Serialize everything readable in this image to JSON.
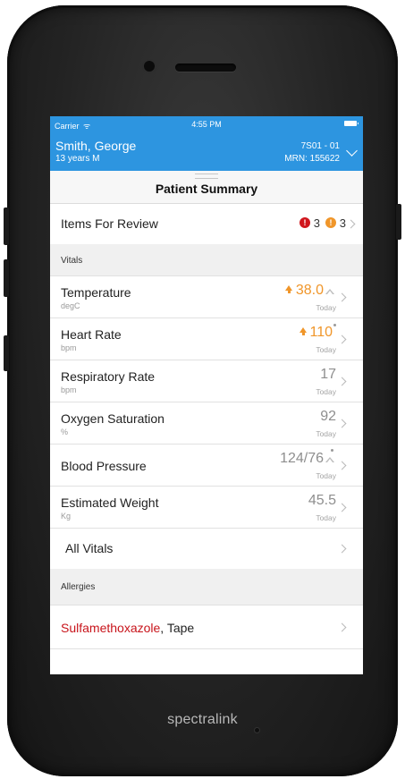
{
  "status_bar": {
    "carrier": "Carrier",
    "wifi_icon": "wifi-icon",
    "time": "4:55 PM",
    "battery_icon": "battery-icon"
  },
  "patient": {
    "name": "Smith, George",
    "age_sex": "13 years  M",
    "location": "7S01 - 01",
    "mrn": "MRN: 155622"
  },
  "page_title": "Patient Summary",
  "review": {
    "label": "Items For Review",
    "red_count": "3",
    "orange_count": "3",
    "red_icon": "!",
    "orange_icon": "!"
  },
  "sections": {
    "vitals": "Vitals",
    "allergies": "Allergies"
  },
  "vitals": [
    {
      "label": "Temperature",
      "unit": "degC",
      "value": "38.0",
      "when": "Today",
      "abnormal": true,
      "trend": true
    },
    {
      "label": "Heart Rate",
      "unit": "bpm",
      "value": "110",
      "when": "Today",
      "abnormal": true,
      "note_dot": true
    },
    {
      "label": "Respiratory Rate",
      "unit": "bpm",
      "value": "17",
      "when": "Today"
    },
    {
      "label": "Oxygen Saturation",
      "unit": "%",
      "value": "92",
      "when": "Today"
    },
    {
      "label": "Blood Pressure",
      "unit": "",
      "value": "124/76",
      "when": "Today",
      "trend": true,
      "note_dot": true
    },
    {
      "label": "Estimated Weight",
      "unit": "Kg",
      "value": "45.5",
      "when": "Today"
    }
  ],
  "all_vitals": "All Vitals",
  "allergies": {
    "primary": "Sulfamethoxazole",
    "rest": ", Tape"
  },
  "colors": {
    "header_blue": "#2d95e0",
    "alert_orange": "#f0962a",
    "alert_red": "#d0161d",
    "allergy_red": "#c8141b"
  },
  "device_brand": "spectralink"
}
